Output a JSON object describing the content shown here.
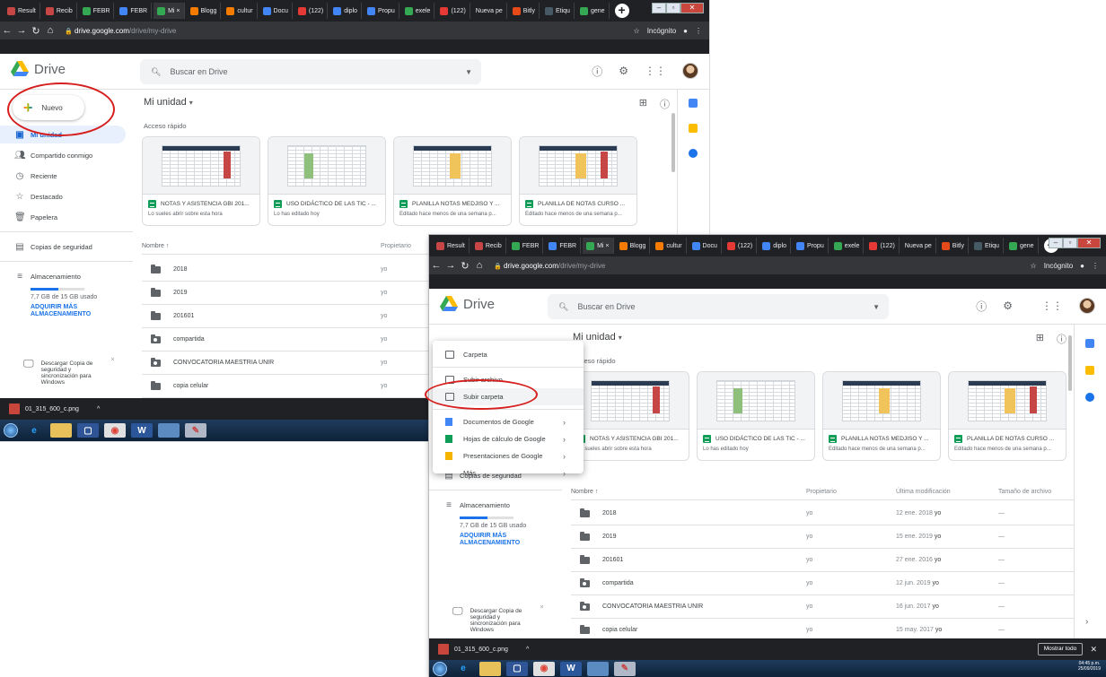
{
  "browser": {
    "tabs": [
      "Result",
      "Recib",
      "FEBR",
      "FEBR",
      "Mi ×",
      "Blogg",
      "cultur",
      "Docu",
      "(122)",
      "diplo",
      "Propu",
      "exele",
      "(122)",
      "Nueva pe",
      "Bitly",
      "Etiqu",
      "gene"
    ],
    "tab_colors": [
      "#c64545",
      "#c64545",
      "#4285f4",
      "#4285f4",
      "#34a853",
      "#f9a825",
      "#f9a825",
      "#4285f4",
      "#e53935",
      "#4285f4",
      "#4285f4",
      "#34a853",
      "#e53935",
      "#9e9e9e",
      "#e64a19",
      "#455a64",
      "#34a853"
    ],
    "url_host": "drive.google.com",
    "url_path": "/drive/my-drive",
    "incognito": "Incógnito"
  },
  "drive": {
    "logo": "Drive",
    "search_placeholder": "Buscar en Drive",
    "new_button": "Nuevo",
    "nav": [
      "Mi unidad",
      "Compartido conmigo",
      "Reciente",
      "Destacado",
      "Papelera"
    ],
    "nav_icons": [
      "my-drive-icon",
      "shared-icon",
      "clock-icon",
      "star-icon",
      "trash-icon"
    ],
    "backups": "Copias de seguridad",
    "storage_label": "Almacenamiento",
    "storage_used": "7,7 GB de 15 GB usado",
    "storage_fraction": 0.51,
    "buy_storage": "ADQUIRIR MÁS ALMACENAMIENTO",
    "download_promo": "Descargar Copia de seguridad y sincronización para Windows",
    "title": "Mi unidad",
    "quick_access": "Acceso rápido",
    "cards": [
      {
        "name": "NOTAS Y ASISTENCIA GBI 201...",
        "sub": "Lo sueles abrir sobre esta hora"
      },
      {
        "name": "USO DIDÁCTICO DE LAS TIC - ...",
        "sub": "Lo has editado hoy"
      },
      {
        "name": "PLANILLA NOTAS MEDJISO Y ...",
        "sub": "Editado hace menos de una semana p..."
      },
      {
        "name": "PLANILLA DE NOTAS CURSO ...",
        "sub": "Editado hace menos de una semana p..."
      }
    ],
    "columns": {
      "name": "Nombre ↑",
      "owner": "Propietario",
      "modified": "Última modificación",
      "size": "Tamaño de archivo"
    },
    "files": [
      {
        "name": "2018",
        "owner": "yo",
        "date": "12 ene. 2018",
        "by": "yo",
        "size": "—"
      },
      {
        "name": "2019",
        "owner": "yo",
        "date": "15 ene. 2019",
        "by": "yo",
        "size": "—"
      },
      {
        "name": "201601",
        "owner": "yo",
        "date": "27 ene. 2016",
        "by": "yo",
        "size": "—"
      },
      {
        "name": "compartida",
        "owner": "yo",
        "date": "12 jun. 2019",
        "by": "yo",
        "size": "—"
      },
      {
        "name": "CONVOCATORIA MAESTRIA UNIR",
        "owner": "yo",
        "date": "16 jun. 2017",
        "by": "yo",
        "size": "—"
      },
      {
        "name": "copia celular",
        "owner": "yo",
        "date": "15 may. 2017",
        "by": "yo",
        "size": "—"
      }
    ]
  },
  "menu": {
    "items": [
      "Carpeta",
      "Subir archivo",
      "Subir carpeta",
      "Documentos de Google",
      "Hojas de cálculo de Google",
      "Presentaciones de Google",
      "Más"
    ],
    "colors": {
      "docs": "#4285f4",
      "sheets": "#0f9d58",
      "slides": "#f4b400"
    }
  },
  "downloads": {
    "file": "01_315_600_c.png",
    "show_all": "Mostrar todo"
  },
  "taskbar": {
    "clock_time": "04:45 p.m.",
    "clock_date": "25/09/2019"
  },
  "colors": {
    "accent": "#1a73e8",
    "annotation_ring": "#d61f1f"
  }
}
